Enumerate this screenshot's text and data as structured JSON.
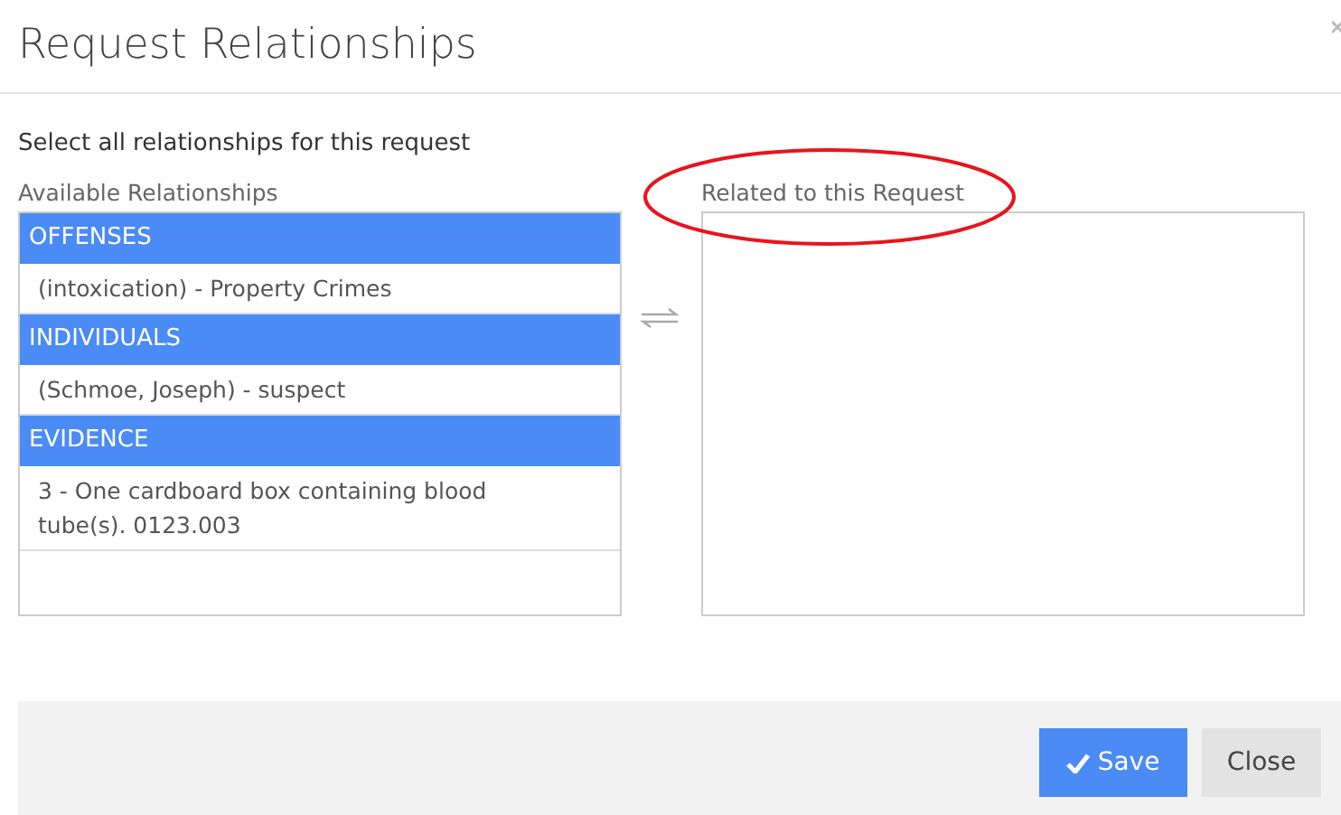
{
  "dialog": {
    "title": "Request Relationships"
  },
  "instructions": "Select all relationships for this request",
  "available": {
    "label": "Available Relationships",
    "groups": [
      {
        "heading": "OFFENSES",
        "items": [
          "(intoxication) - Property Crimes"
        ]
      },
      {
        "heading": "INDIVIDUALS",
        "items": [
          "(Schmoe, Joseph) - suspect"
        ]
      },
      {
        "heading": "EVIDENCE",
        "items": [
          "3 - One cardboard box containing blood tube(s). 0123.003"
        ]
      }
    ]
  },
  "related": {
    "label": "Related to this Request"
  },
  "buttons": [
    {
      "label": "Save",
      "kind": "primary"
    },
    {
      "label": "Close",
      "kind": "secondary"
    }
  ]
}
